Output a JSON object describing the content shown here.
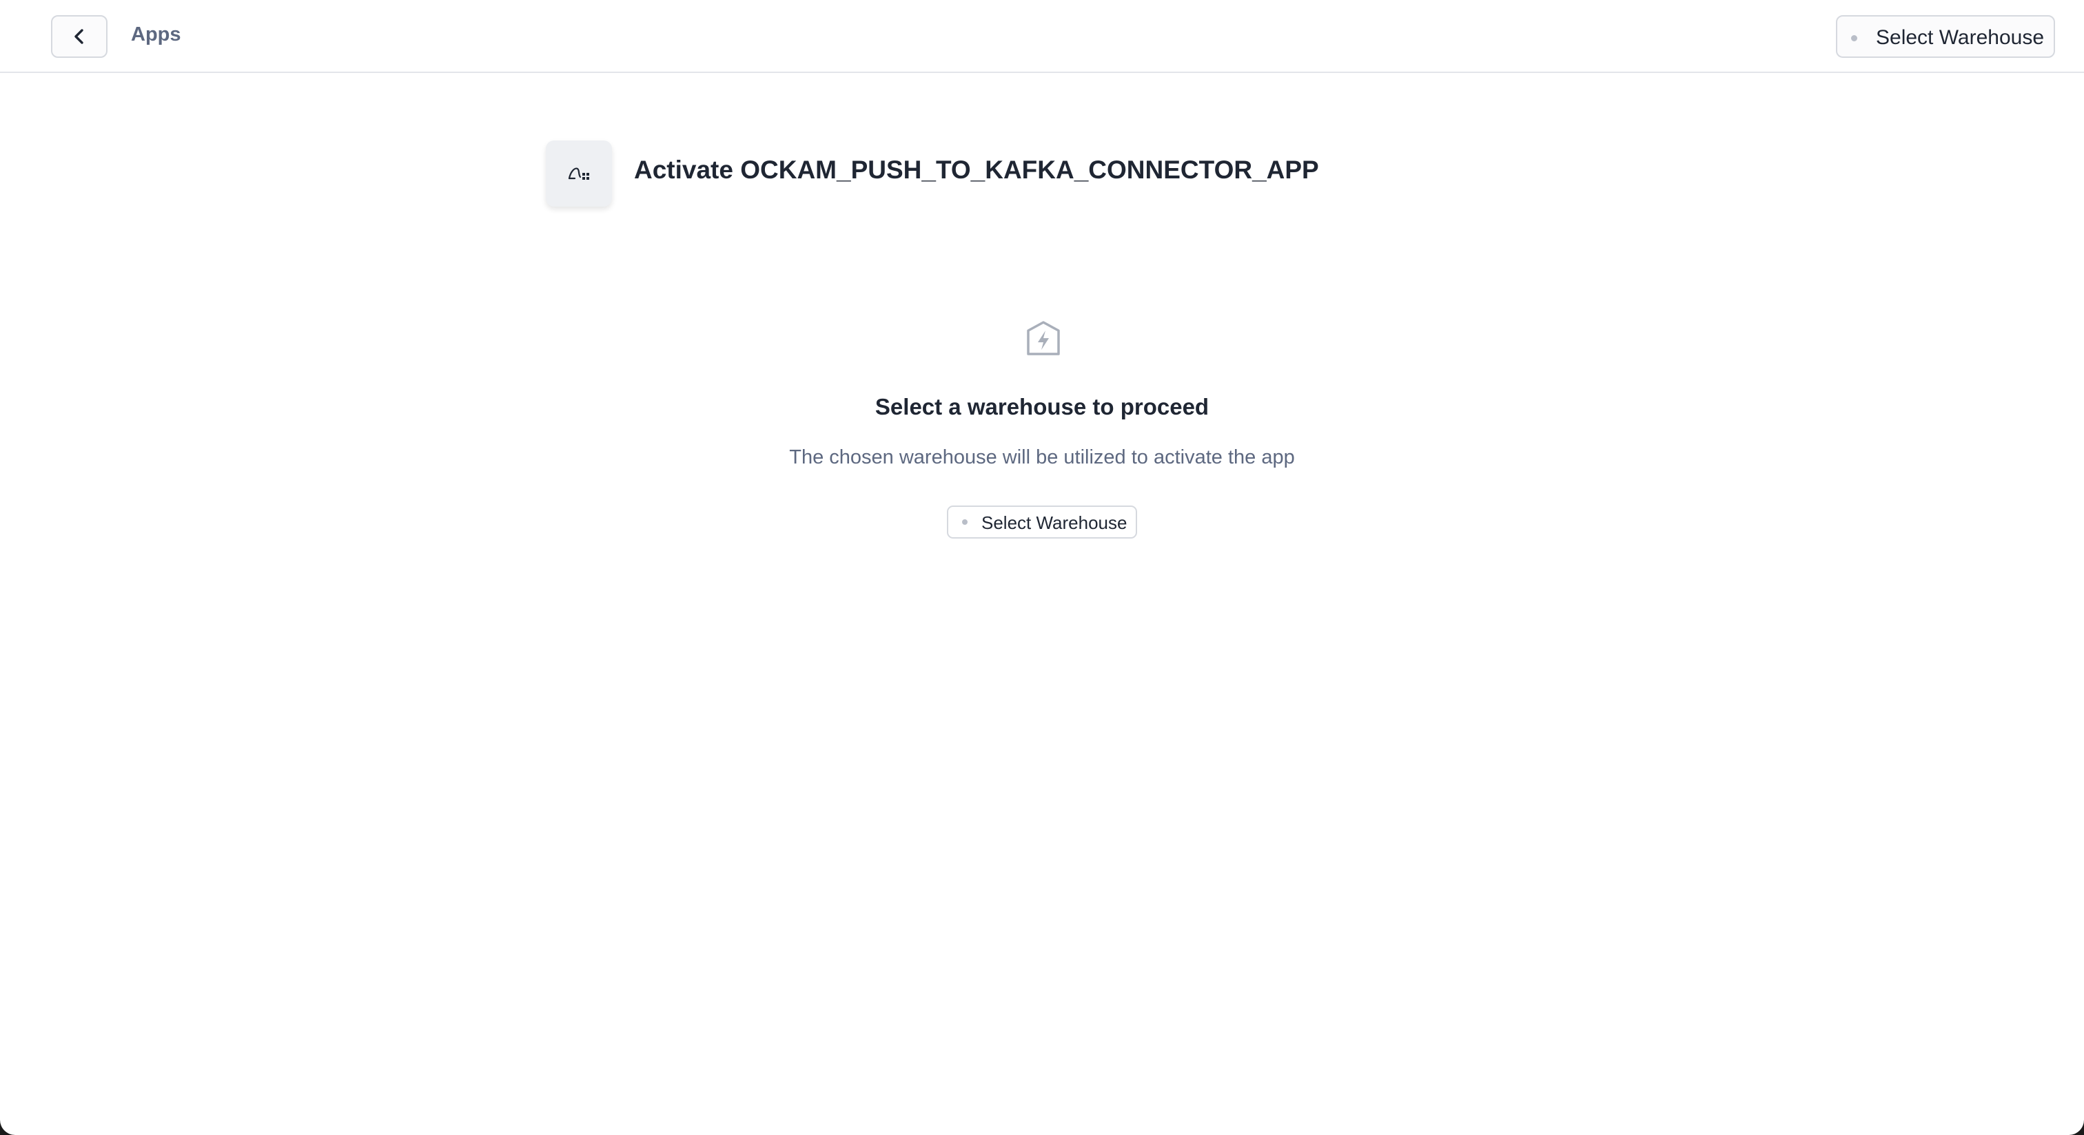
{
  "header": {
    "breadcrumb": "Apps",
    "warehouse_button_label": "Select Warehouse"
  },
  "main": {
    "title": "Activate OCKAM_PUSH_TO_KAFKA_CONNECTOR_APP",
    "app_icon": "app-logo-icon"
  },
  "empty_state": {
    "icon": "bolt-house-icon",
    "heading": "Select a warehouse to proceed",
    "description": "The chosen warehouse will be utilized to activate the app",
    "button_label": "Select Warehouse"
  },
  "colors": {
    "text_primary": "#1f2633",
    "text_secondary": "#5d6880",
    "border": "#d6d9df",
    "status_dot": "#b9bec8"
  }
}
